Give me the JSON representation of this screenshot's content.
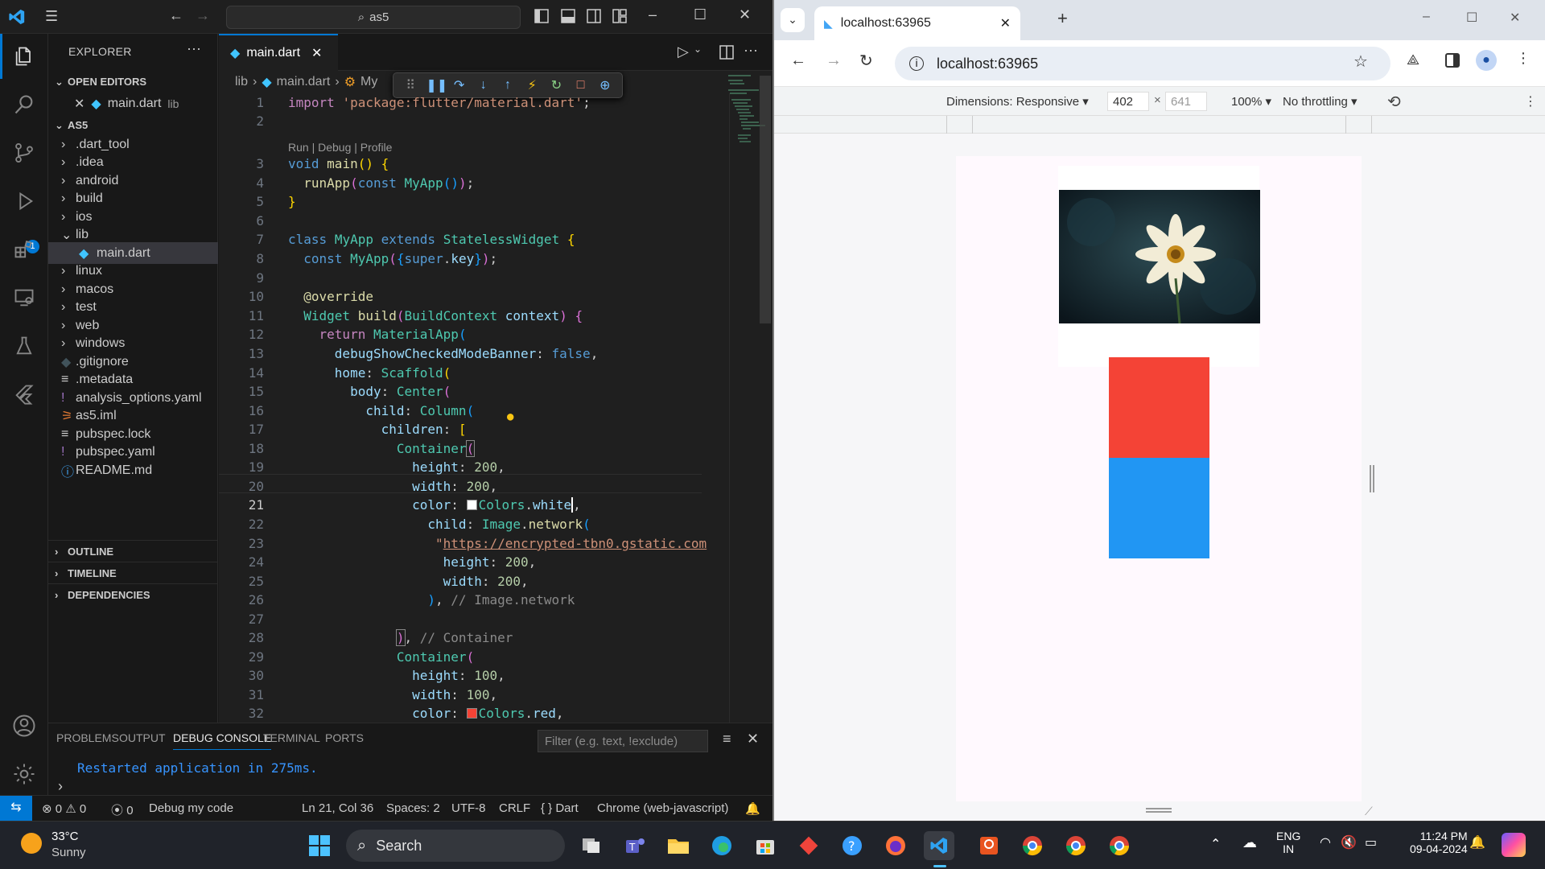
{
  "vscode": {
    "search_text": "as5",
    "explorer_title": "EXPLORER",
    "open_editors_label": "OPEN EDITORS",
    "open_editor_file": "main.dart",
    "open_editor_folder": "lib",
    "project_label": "AS5",
    "tree": [
      ".dart_tool",
      ".idea",
      "android",
      "build",
      "ios",
      "lib",
      "main.dart",
      "linux",
      "macos",
      "test",
      "web",
      "windows",
      ".gitignore",
      ".metadata",
      "analysis_options.yaml",
      "as5.iml",
      "pubspec.lock",
      "pubspec.yaml",
      "README.md"
    ],
    "outline_label": "OUTLINE",
    "timeline_label": "TIMELINE",
    "dependencies_label": "DEPENDENCIES",
    "debug_badge": "1",
    "tab_label": "main.dart",
    "breadcrumb": [
      "lib",
      "main.dart",
      "My"
    ],
    "codelens": "Run | Debug | Profile",
    "line_numbers": [
      "1",
      "2",
      "3",
      "4",
      "5",
      "6",
      "7",
      "8",
      "9",
      "10",
      "11",
      "12",
      "13",
      "14",
      "15",
      "16",
      "17",
      "18",
      "19",
      "20",
      "21",
      "22",
      "23",
      "24",
      "25",
      "26",
      "27",
      "28",
      "29",
      "30",
      "31",
      "32"
    ],
    "active_line": "21",
    "code_strings": {
      "import_stmt": "import",
      "import_path": "'package:flutter/material.dart'",
      "url": "https://encrypted-tbn0.gstatic.com",
      "comment_image": "// Image.network",
      "comment_container": "// Container"
    },
    "panel_tabs": [
      "PROBLEMS",
      "OUTPUT",
      "DEBUG CONSOLE",
      "TERMINAL",
      "PORTS"
    ],
    "active_panel_tab": "DEBUG CONSOLE",
    "filter_placeholder": "Filter (e.g. text, !exclude)",
    "console_output": "Restarted application in 275ms.",
    "status": {
      "errors": "0",
      "warnings": "0",
      "ports": "0",
      "debug_config": "Debug my code",
      "position": "Ln 21, Col 36",
      "spaces": "Spaces: 2",
      "encoding": "UTF-8",
      "eol": "CRLF",
      "language": "{ } Dart",
      "device": "Chrome (web-javascript)"
    }
  },
  "chrome": {
    "tab_title": "localhost:63965",
    "url": "localhost:63965",
    "dimensions_label": "Dimensions: Responsive",
    "width_value": "402",
    "height_value": "641",
    "zoom": "100%",
    "throttling": "No throttling"
  },
  "taskbar": {
    "temperature": "33°C",
    "weather": "Sunny",
    "search_label": "Search",
    "lang_line1": "ENG",
    "lang_line2": "IN",
    "time": "11:24 PM",
    "date": "09-04-2024"
  },
  "colors": {
    "accent": "#0078d4",
    "red_container": "#f44336",
    "blue_container": "#2196f3"
  }
}
